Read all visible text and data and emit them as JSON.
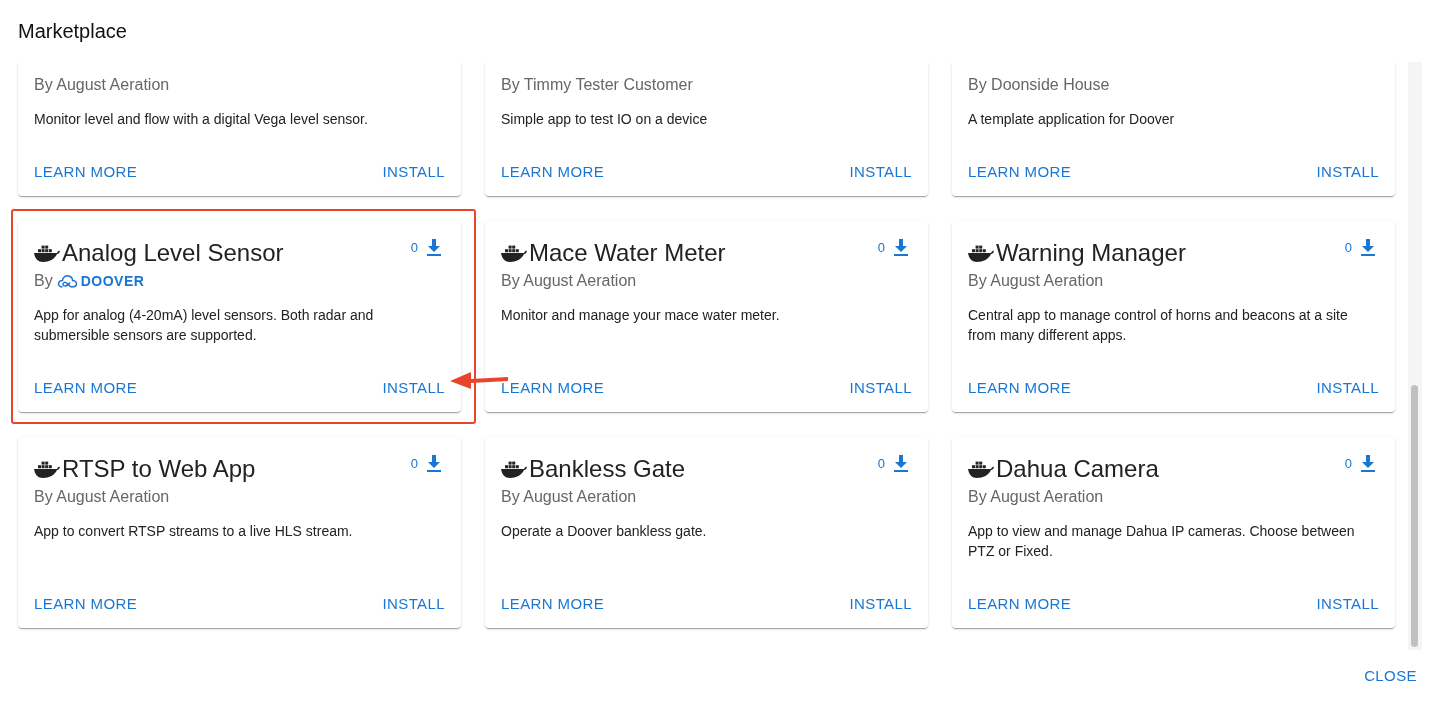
{
  "title": "Marketplace",
  "cards": [
    {
      "kind": "clipped",
      "publisher": "By August Aeration",
      "description": "Monitor level and flow with a digital Vega level sensor.",
      "learn_more": "LEARN MORE",
      "install": "INSTALL",
      "highlighted": false
    },
    {
      "kind": "clipped",
      "publisher": "By Timmy Tester Customer",
      "description": "Simple app to test IO on a device",
      "learn_more": "LEARN MORE",
      "install": "INSTALL",
      "highlighted": false
    },
    {
      "kind": "clipped",
      "publisher": "By Doonside House",
      "description": "A template application for Doover",
      "learn_more": "LEARN MORE",
      "install": "INSTALL",
      "highlighted": false
    },
    {
      "kind": "full",
      "title": "Analog Level Sensor",
      "downloads": "0",
      "by": "By",
      "publisher": "DOOVER",
      "publisher_logo": true,
      "description": "App for analog (4-20mA) level sensors. Both radar and submersible sensors are supported.",
      "learn_more": "LEARN MORE",
      "install": "INSTALL",
      "highlighted": true
    },
    {
      "kind": "full",
      "title": "Mace Water Meter",
      "downloads": "0",
      "publisher": "By August Aeration",
      "description": "Monitor and manage your mace water meter.",
      "learn_more": "LEARN MORE",
      "install": "INSTALL",
      "highlighted": false
    },
    {
      "kind": "full",
      "title": "Warning Manager",
      "downloads": "0",
      "publisher": "By August Aeration",
      "description": "Central app to manage control of horns and beacons at a site from many different apps.",
      "learn_more": "LEARN MORE",
      "install": "INSTALL",
      "highlighted": false
    },
    {
      "kind": "full",
      "title": "RTSP to Web App",
      "downloads": "0",
      "publisher": "By August Aeration",
      "description": "App to convert RTSP streams to a live HLS stream.",
      "learn_more": "LEARN MORE",
      "install": "INSTALL",
      "highlighted": false
    },
    {
      "kind": "full",
      "title": "Bankless Gate",
      "downloads": "0",
      "publisher": "By August Aeration",
      "description": "Operate a Doover bankless gate.",
      "learn_more": "LEARN MORE",
      "install": "INSTALL",
      "highlighted": false
    },
    {
      "kind": "full",
      "title": "Dahua Camera",
      "downloads": "0",
      "publisher": "By August Aeration",
      "description": "App to view and manage Dahua IP cameras. Choose between PTZ or Fixed.",
      "learn_more": "LEARN MORE",
      "install": "INSTALL",
      "highlighted": false
    }
  ],
  "close": "CLOSE"
}
